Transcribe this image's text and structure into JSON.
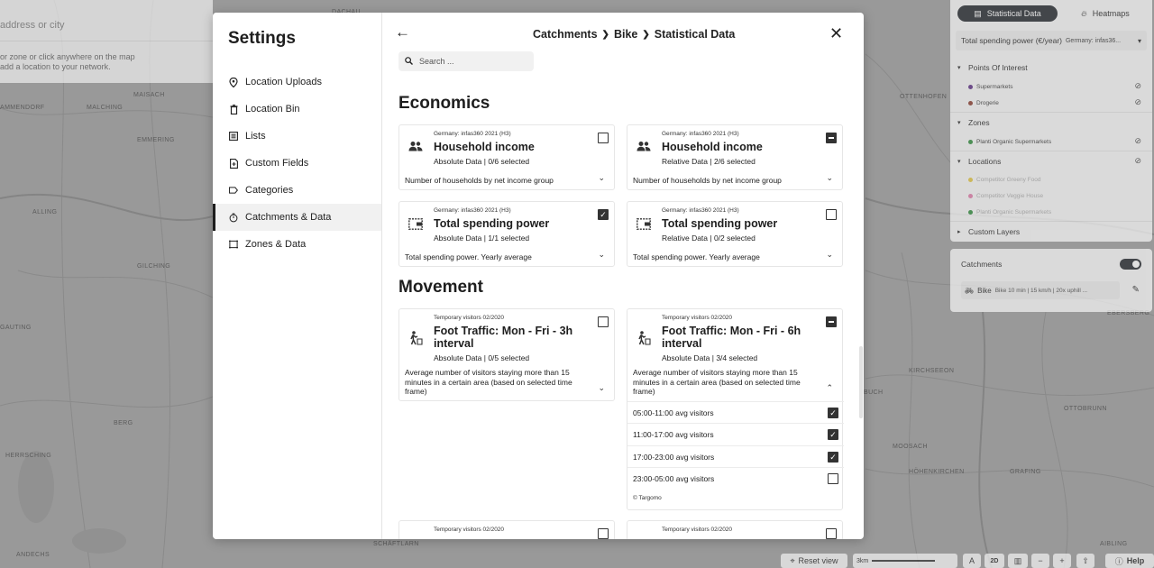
{
  "map": {
    "labels": [
      "MAISACH",
      "AMMENDORF",
      "MALCHING",
      "EMMERING",
      "DACHAU",
      "OTTENHOFEN",
      "ALLING",
      "GILCHING",
      "GAUTING",
      "HERRSCHING",
      "BERG",
      "ANDECHS",
      "SCHÄFTLARN",
      "HÖHENKIRCHEN",
      "OTTOBRUNN",
      "KIRCHSEEON",
      "MOOSACH",
      "GRAFING",
      "BUCH",
      "AIBLING",
      "EBERSBERG"
    ],
    "address_placeholder": "address or city",
    "hint": "or zone or click anywhere on the map\nadd a location to your network."
  },
  "layers_panel": {
    "tab_active": "Statistical Data",
    "tab_inactive": "Heatmaps",
    "selected_layer": "Total spending power (€/year)",
    "selected_layer_sub": "Germany: infas36...",
    "groups": [
      {
        "label": "Points Of Interest",
        "items": [
          {
            "label": "Supermarkets",
            "color": "#5b2c83"
          },
          {
            "label": "Drogerie",
            "color": "#8a3a2c"
          }
        ]
      },
      {
        "label": "Zones",
        "items": [
          {
            "label": "Planti Organic Supermarkets",
            "color": "#2e8b3a"
          }
        ]
      },
      {
        "label": "Locations",
        "items": [
          {
            "label": "Competitor Greeny Food",
            "color": "#e2c540"
          },
          {
            "label": "Competitor Veggie House",
            "color": "#e07aa8"
          },
          {
            "label": "Planti Organic Supermarkets",
            "color": "#2e8b3a"
          }
        ]
      },
      {
        "label": "Custom Layers",
        "items": []
      }
    ]
  },
  "catchments_panel": {
    "title": "Catchments",
    "bike_label": "Bike",
    "bike_sub": "Bike 10 min | 15 km/h | 20x uphill ..."
  },
  "bottom_bar": {
    "reset_view": "Reset view",
    "scale": "3km",
    "mode_2d": "2D",
    "help": "Help"
  },
  "modal": {
    "settings_title": "Settings",
    "nav": [
      {
        "label": "Location Uploads",
        "icon": "pin-icon"
      },
      {
        "label": "Location Bin",
        "icon": "bin-icon"
      },
      {
        "label": "Lists",
        "icon": "list-icon"
      },
      {
        "label": "Custom Fields",
        "icon": "document-icon"
      },
      {
        "label": "Categories",
        "icon": "tag-icon"
      },
      {
        "label": "Catchments & Data",
        "icon": "timer-icon"
      },
      {
        "label": "Zones & Data",
        "icon": "zone-icon"
      }
    ],
    "breadcrumb": [
      "Catchments",
      "Bike",
      "Statistical Data"
    ],
    "search_placeholder": "Search ...",
    "sections": {
      "economics": "Economics",
      "movement": "Movement"
    },
    "cards": {
      "hh_abs": {
        "source": "Germany: infas360 2021 (H3)",
        "name": "Household income",
        "meta": "Absolute Data | 0/6 selected",
        "desc": "Number of households by net income group"
      },
      "hh_rel": {
        "source": "Germany: infas360 2021 (H3)",
        "name": "Household income",
        "meta": "Relative Data | 2/6 selected",
        "desc": "Number of households by net income group"
      },
      "sp_abs": {
        "source": "Germany: infas360 2021 (H3)",
        "name": "Total spending power",
        "meta": "Absolute Data | 1/1 selected",
        "desc": "Total spending power. Yearly average"
      },
      "sp_rel": {
        "source": "Germany: infas360 2021 (H3)",
        "name": "Total spending power",
        "meta": "Relative Data | 0/2 selected",
        "desc": "Total spending power. Yearly average"
      },
      "ft3": {
        "source": "Temporary visitors 02/2020",
        "name": "Foot Traffic: Mon - Fri - 3h interval",
        "meta": "Absolute Data | 0/5 selected",
        "desc": "Average number of visitors staying more than 15 minutes in a certain area (based on selected time frame)"
      },
      "ft6": {
        "source": "Temporary visitors 02/2020",
        "name": "Foot Traffic: Mon - Fri - 6h interval",
        "meta": "Absolute Data | 3/4 selected",
        "desc": "Average number of visitors staying more than 15 minutes in a certain area (based on selected time frame)",
        "rows": [
          "05:00-11:00 avg visitors",
          "11:00-17:00 avg visitors",
          "17:00-23:00 avg visitors",
          "23:00-05:00 avg visitors"
        ],
        "footer": "© Targomo"
      },
      "next_a": {
        "source": "Temporary visitors 02/2020"
      },
      "next_b": {
        "source": "Temporary visitors 02/2020"
      }
    }
  }
}
